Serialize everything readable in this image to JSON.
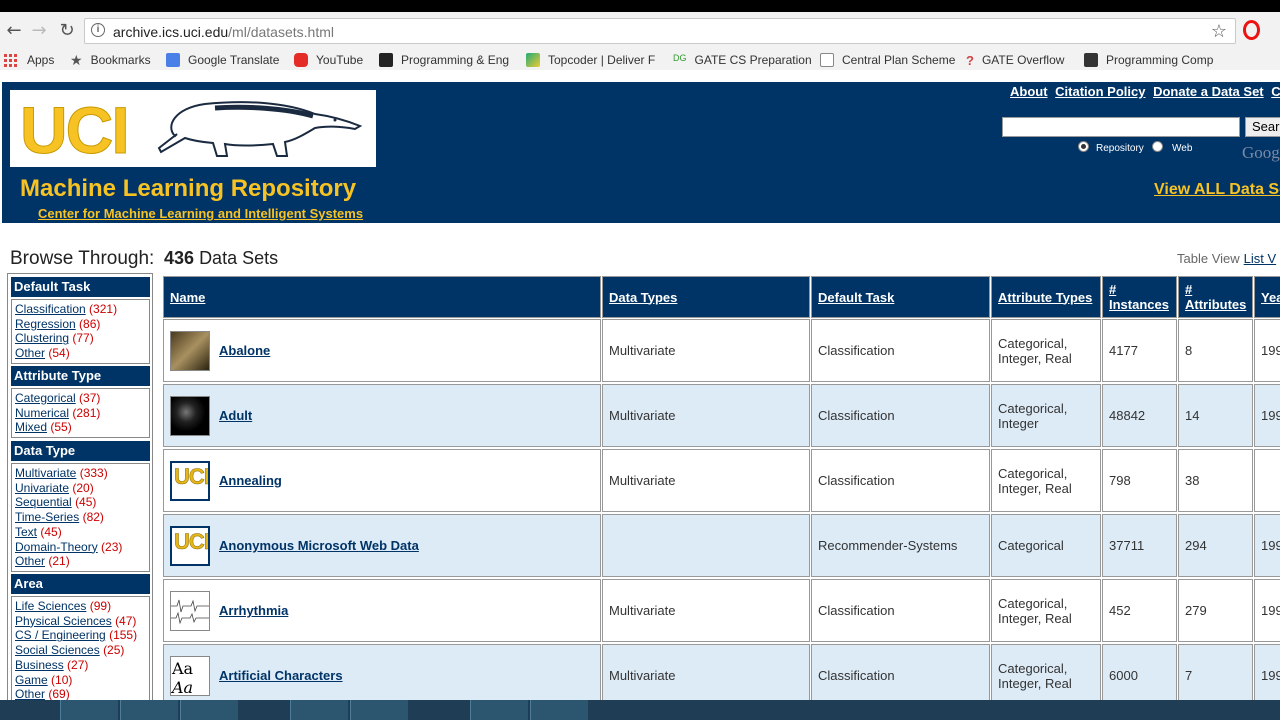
{
  "browser": {
    "url_host": "archive.ics.uci.edu",
    "url_path": "/ml/datasets.html",
    "bookmarks": [
      "Apps",
      "Bookmarks",
      "Google Translate",
      "YouTube",
      "Programming & Eng",
      "Topcoder | Deliver F",
      "GATE CS Preparation",
      "Central Plan Scheme",
      "GATE Overflow",
      "Programming Comp"
    ]
  },
  "header": {
    "logo_text": "UCI",
    "title": "Machine Learning Repository",
    "subtitle": "Center for Machine Learning and Intelligent Systems",
    "links": [
      "About",
      "Citation Policy",
      "Donate a Data Set",
      "Con"
    ],
    "search_button": "Sear",
    "radio_repository": "Repository",
    "radio_web": "Web",
    "google_text": "Goog",
    "view_all": "View ALL Data Se"
  },
  "browse": {
    "label": "Browse Through:",
    "count": "436",
    "count_suffix": "Data Sets",
    "table_view": "Table View",
    "list_view": "List V"
  },
  "sidebar": {
    "sections": [
      {
        "title": "Default Task",
        "items": [
          {
            "label": "Classification",
            "count": "(321)"
          },
          {
            "label": "Regression",
            "count": "(86)"
          },
          {
            "label": "Clustering",
            "count": "(77)"
          },
          {
            "label": "Other",
            "count": "(54)"
          }
        ]
      },
      {
        "title": "Attribute Type",
        "items": [
          {
            "label": "Categorical",
            "count": "(37)"
          },
          {
            "label": "Numerical",
            "count": "(281)"
          },
          {
            "label": "Mixed",
            "count": "(55)"
          }
        ]
      },
      {
        "title": "Data Type",
        "items": [
          {
            "label": "Multivariate",
            "count": "(333)"
          },
          {
            "label": "Univariate",
            "count": "(20)"
          },
          {
            "label": "Sequential",
            "count": "(45)"
          },
          {
            "label": "Time-Series",
            "count": "(82)"
          },
          {
            "label": "Text",
            "count": "(45)"
          },
          {
            "label": "Domain-Theory",
            "count": "(23)"
          },
          {
            "label": "Other",
            "count": "(21)"
          }
        ]
      },
      {
        "title": "Area",
        "items": [
          {
            "label": "Life Sciences",
            "count": "(99)"
          },
          {
            "label": "Physical Sciences",
            "count": "(47)"
          },
          {
            "label": "CS / Engineering",
            "count": "(155)"
          },
          {
            "label": "Social Sciences",
            "count": "(25)"
          },
          {
            "label": "Business",
            "count": "(27)"
          },
          {
            "label": "Game",
            "count": "(10)"
          },
          {
            "label": "Other",
            "count": "(69)"
          }
        ]
      }
    ]
  },
  "table": {
    "headers": [
      "Name",
      "Data Types",
      "Default Task",
      "Attribute Types",
      "# Instances",
      "# Attributes",
      "Yea"
    ],
    "rows": [
      {
        "name": "Abalone",
        "thumb": "abalone",
        "data_types": "Multivariate",
        "task": "Classification",
        "attr_types": "Categorical, Integer, Real",
        "instances": "4177",
        "attributes": "8",
        "year": "199"
      },
      {
        "name": "Adult",
        "thumb": "adult",
        "data_types": "Multivariate",
        "task": "Classification",
        "attr_types": "Categorical, Integer",
        "instances": "48842",
        "attributes": "14",
        "year": "199"
      },
      {
        "name": "Annealing",
        "thumb": "uci",
        "data_types": "Multivariate",
        "task": "Classification",
        "attr_types": "Categorical, Integer, Real",
        "instances": "798",
        "attributes": "38",
        "year": ""
      },
      {
        "name": "Anonymous Microsoft Web Data",
        "thumb": "uci",
        "data_types": "",
        "task": "Recommender-Systems",
        "attr_types": "Categorical",
        "instances": "37711",
        "attributes": "294",
        "year": "199"
      },
      {
        "name": "Arrhythmia",
        "thumb": "ecg",
        "data_types": "Multivariate",
        "task": "Classification",
        "attr_types": "Categorical, Integer, Real",
        "instances": "452",
        "attributes": "279",
        "year": "199"
      },
      {
        "name": "Artificial Characters",
        "thumb": "chars",
        "data_types": "Multivariate",
        "task": "Classification",
        "attr_types": "Categorical, Integer, Real",
        "instances": "6000",
        "attributes": "7",
        "year": "199"
      }
    ]
  },
  "colors": {
    "brand_navy": "#003366",
    "brand_gold": "#f7c324",
    "count_red": "#cc0000",
    "row_alt": "#ddebf7"
  }
}
